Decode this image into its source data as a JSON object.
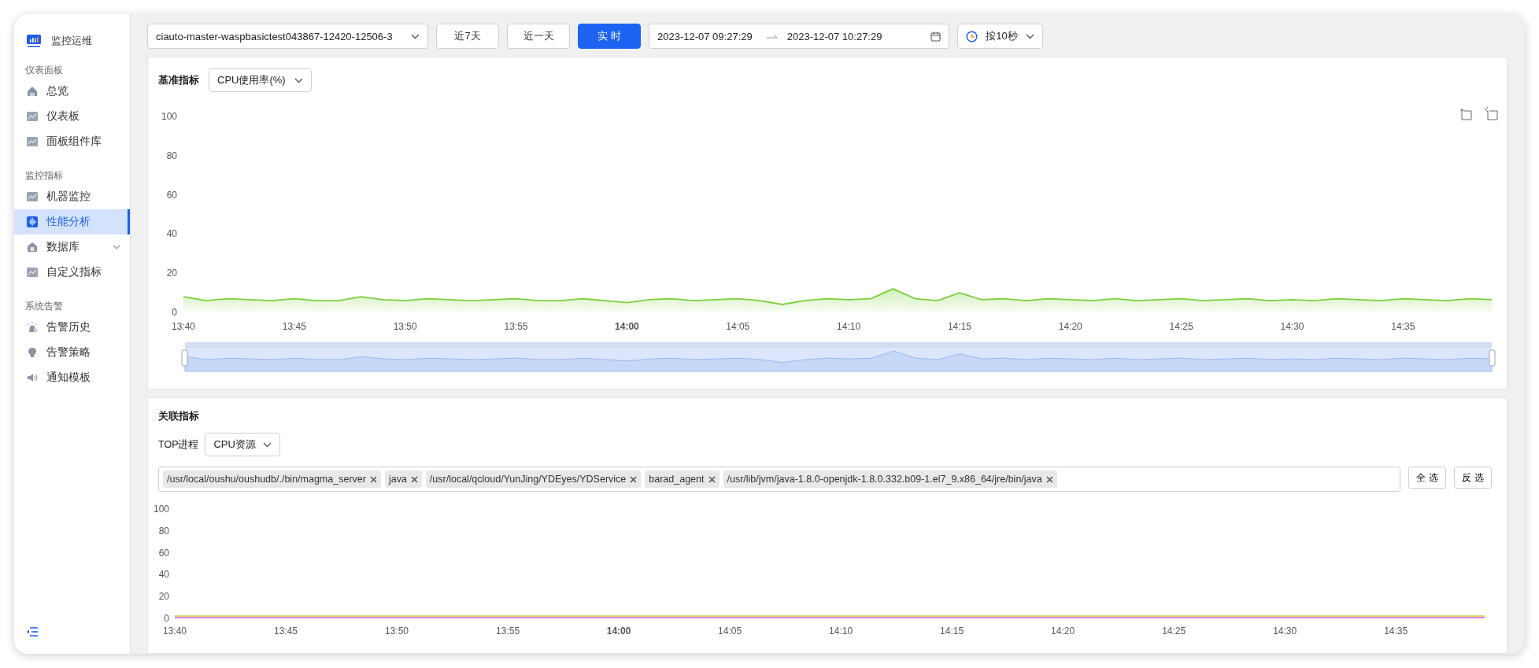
{
  "sidebar": {
    "brand": "监控运维",
    "sections": [
      {
        "title": "仪表面板",
        "items": [
          {
            "label": "总览",
            "selected": false,
            "expandable": false
          },
          {
            "label": "仪表板",
            "selected": false,
            "expandable": false
          },
          {
            "label": "面板组件库",
            "selected": false,
            "expandable": false
          }
        ]
      },
      {
        "title": "监控指标",
        "items": [
          {
            "label": "机器监控",
            "selected": false,
            "expandable": false
          },
          {
            "label": "性能分析",
            "selected": true,
            "expandable": false
          },
          {
            "label": "数据库",
            "selected": false,
            "expandable": true
          },
          {
            "label": "自定义指标",
            "selected": false,
            "expandable": false
          }
        ]
      },
      {
        "title": "系统告警",
        "items": [
          {
            "label": "告警历史",
            "selected": false,
            "expandable": false
          },
          {
            "label": "告警策略",
            "selected": false,
            "expandable": false
          },
          {
            "label": "通知模板",
            "selected": false,
            "expandable": false
          }
        ]
      }
    ]
  },
  "toolbar": {
    "instance": {
      "value": "ciauto-master-waspbasictest043867-12420-12506-3"
    },
    "range_buttons": [
      {
        "label": "近7天",
        "selected": false
      },
      {
        "label": "近一天",
        "selected": false
      },
      {
        "label": "实 时",
        "selected": true
      }
    ],
    "date_range": {
      "start": "2023-12-07 09:27:29",
      "end": "2023-12-07 10:27:29"
    },
    "interval": {
      "value": "按10秒"
    }
  },
  "base_panel": {
    "title": "基准指标",
    "metric": {
      "value": "CPU使用率(%)"
    },
    "chart_data": {
      "type": "area",
      "categories": [
        "13:40",
        null,
        null,
        null,
        null,
        "13:45",
        null,
        null,
        null,
        null,
        "13:50",
        null,
        null,
        null,
        null,
        "13:55",
        null,
        null,
        null,
        null,
        "14:00",
        null,
        null,
        null,
        null,
        "14:05",
        null,
        null,
        null,
        null,
        "14:10",
        null,
        null,
        null,
        null,
        "14:15",
        null,
        null,
        null,
        null,
        "14:20",
        null,
        null,
        null,
        null,
        "14:25",
        null,
        null,
        null,
        null,
        "14:30",
        null,
        null,
        null,
        null,
        "14:35",
        null,
        null,
        null,
        null
      ],
      "series": [
        {
          "color": "#7cd03b",
          "values": [
            8,
            6,
            7,
            6.5,
            6,
            7,
            6,
            6,
            8,
            6.5,
            6,
            7,
            6.5,
            6,
            6.5,
            7,
            6,
            6,
            7,
            6,
            5,
            6.5,
            7,
            6,
            6.5,
            7,
            6,
            4,
            6,
            7,
            6.5,
            7,
            12,
            7,
            6,
            10,
            6.5,
            7,
            6,
            7,
            6.5,
            6,
            7,
            6,
            6.5,
            7,
            6,
            6.5,
            7,
            6,
            6.5,
            6,
            7,
            6.5,
            6,
            7,
            6.5,
            6,
            7,
            6.5
          ]
        }
      ],
      "ylim": [
        0,
        100
      ],
      "yticks": [
        0,
        20,
        40,
        60,
        80,
        100
      ]
    }
  },
  "related_panel": {
    "title": "关联指标",
    "top_label": "TOP进程",
    "resource": {
      "value": "CPU资源"
    },
    "processes": [
      {
        "label": "/usr/local/oushu/oushudb/./bin/magma_server"
      },
      {
        "label": "java"
      },
      {
        "label": "/usr/local/qcloud/YunJing/YDEyes/YDService"
      },
      {
        "label": "barad_agent"
      },
      {
        "label": "/usr/lib/jvm/java-1.8.0-openjdk-1.8.0.332.b09-1.el7_9.x86_64/jre/bin/java"
      }
    ],
    "buttons": [
      "全 选",
      "反 选"
    ],
    "chart_data": {
      "type": "line",
      "categories": [
        "13:40",
        null,
        null,
        null,
        null,
        "13:45",
        null,
        null,
        null,
        null,
        "13:50",
        null,
        null,
        null,
        null,
        "13:55",
        null,
        null,
        null,
        null,
        "14:00",
        null,
        null,
        null,
        null,
        "14:05",
        null,
        null,
        null,
        null,
        "14:10",
        null,
        null,
        null,
        null,
        "14:15",
        null,
        null,
        null,
        null,
        "14:20",
        null,
        null,
        null,
        null,
        "14:25",
        null,
        null,
        null,
        null,
        "14:30",
        null,
        null,
        null,
        null,
        "14:35",
        null,
        null,
        null,
        null
      ],
      "series": [
        {
          "color": "#c9c63c",
          "values": [
            1.5,
            1.5,
            1.5,
            1.5,
            1.5,
            1.5,
            1.5,
            1.5,
            1.5,
            1.5,
            1.5,
            1.5,
            1.5,
            1.5,
            1.5,
            1.5,
            1.5,
            1.5,
            1.5,
            1.5,
            1.5,
            1.5,
            1.5,
            1.5,
            1.5,
            1.5,
            1.5,
            1.5,
            1.5,
            1.5,
            1.5,
            1.5,
            1.5,
            1.5,
            1.5,
            1.5,
            1.5,
            1.5,
            1.5,
            1.5,
            1.5,
            1.5,
            1.5,
            1.5,
            1.5,
            1.5,
            1.5,
            1.5,
            1.5,
            1.5,
            1.5,
            1.5,
            1.5,
            1.5,
            1.5,
            1.5,
            1.5,
            1.5,
            1.5,
            1.5
          ]
        },
        {
          "color": "#e05ee8",
          "values": [
            0,
            0,
            0,
            0,
            0,
            0,
            0,
            0,
            0,
            0,
            0,
            0,
            0,
            0,
            0,
            0,
            0,
            0,
            0,
            0,
            0,
            0,
            0,
            0,
            0,
            0,
            0,
            0,
            0,
            0,
            0,
            0,
            0,
            0,
            0,
            0,
            0,
            0,
            0,
            0,
            0,
            0,
            0,
            0,
            0,
            0,
            0,
            0,
            0,
            0,
            0,
            0,
            0,
            0,
            0,
            0,
            0,
            0,
            0,
            0
          ]
        }
      ],
      "ylim": [
        0,
        100
      ],
      "yticks": [
        0,
        20,
        40,
        60,
        80,
        100
      ]
    }
  }
}
